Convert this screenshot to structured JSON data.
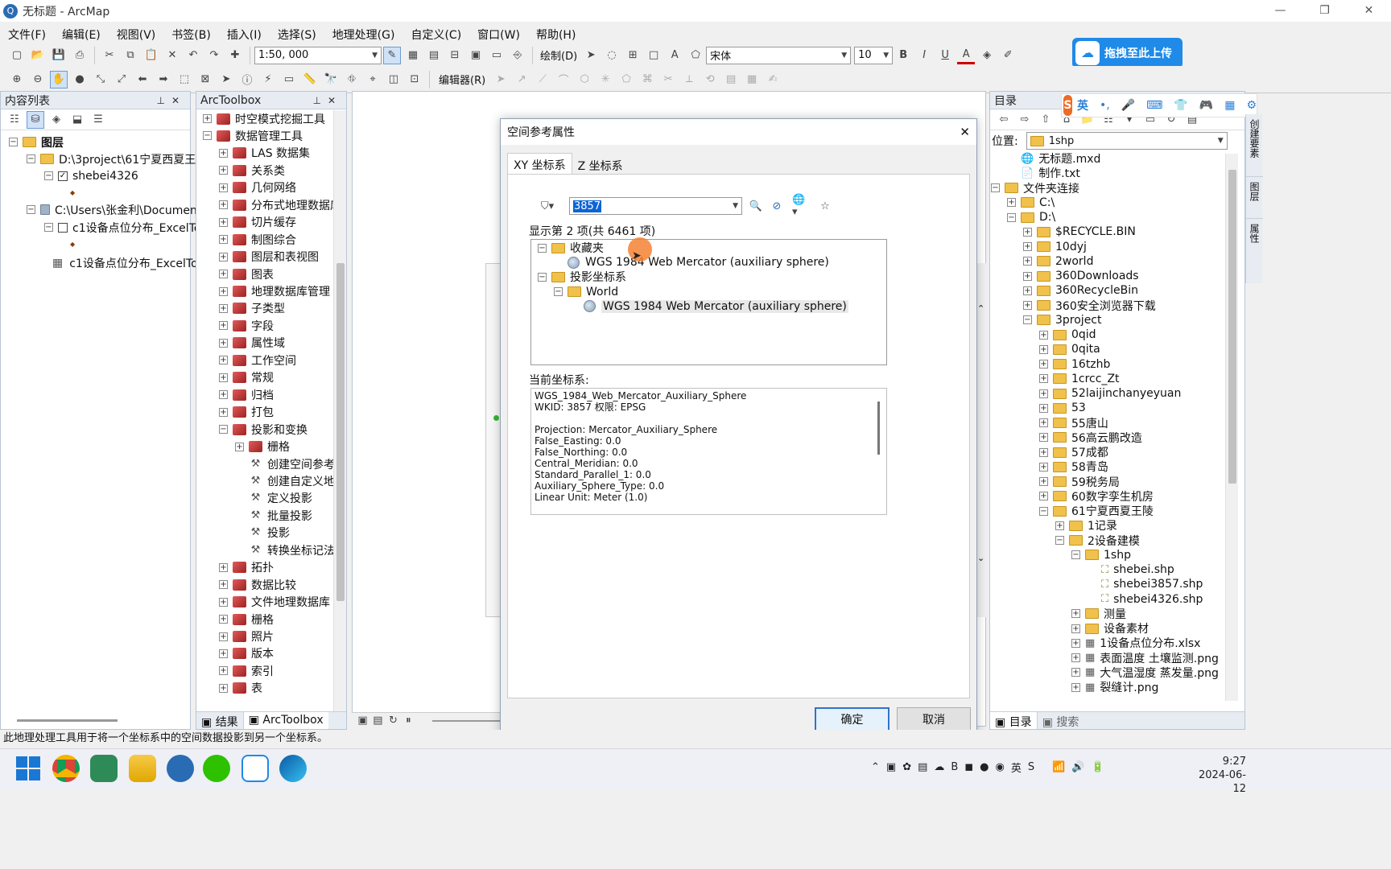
{
  "window": {
    "title": "无标题 - ArcMap",
    "minimize": "—",
    "restore": "❐",
    "close": "✕"
  },
  "menu": [
    "文件(F)",
    "编辑(E)",
    "视图(V)",
    "书签(B)",
    "插入(I)",
    "选择(S)",
    "地理处理(G)",
    "自定义(C)",
    "窗口(W)",
    "帮助(H)"
  ],
  "toolbar": {
    "scale": "1:50, 000",
    "draw_label": "绘制(D)",
    "font_name": "宋体",
    "font_size": "10",
    "bold": "B",
    "italic": "I",
    "underline": "U",
    "font_color": "A",
    "upload_button": "拖拽至此上传",
    "editor_label": "编辑器(R)"
  },
  "toc": {
    "title": "内容列表",
    "items": [
      {
        "label": "图层",
        "level": 0
      },
      {
        "label": "D:\\3project\\61宁夏西夏王陵",
        "level": 1
      },
      {
        "label": "shebei4326",
        "level": 2,
        "checked": true
      },
      {
        "label": "C:\\Users\\张金利\\Document",
        "level": 1
      },
      {
        "label": "c1设备点位分布_ExcelTo",
        "level": 2,
        "checked": false
      },
      {
        "label": "c1设备点位分布_ExcelTo",
        "level": 2,
        "table": true
      }
    ]
  },
  "toolbox": {
    "title": "ArcToolbox",
    "items": [
      {
        "label": "时空模式挖掘工具",
        "level": 0,
        "type": "box",
        "pm": "+"
      },
      {
        "label": "数据管理工具",
        "level": 0,
        "type": "box",
        "pm": "-"
      },
      {
        "label": "LAS 数据集",
        "level": 1,
        "type": "box",
        "pm": "+"
      },
      {
        "label": "关系类",
        "level": 1,
        "type": "box",
        "pm": "+"
      },
      {
        "label": "几何网络",
        "level": 1,
        "type": "box",
        "pm": "+"
      },
      {
        "label": "分布式地理数据库",
        "level": 1,
        "type": "box",
        "pm": "+"
      },
      {
        "label": "切片缓存",
        "level": 1,
        "type": "box",
        "pm": "+"
      },
      {
        "label": "制图综合",
        "level": 1,
        "type": "box",
        "pm": "+"
      },
      {
        "label": "图层和表视图",
        "level": 1,
        "type": "box",
        "pm": "+"
      },
      {
        "label": "图表",
        "level": 1,
        "type": "box",
        "pm": "+"
      },
      {
        "label": "地理数据库管理",
        "level": 1,
        "type": "box",
        "pm": "+"
      },
      {
        "label": "子类型",
        "level": 1,
        "type": "box",
        "pm": "+"
      },
      {
        "label": "字段",
        "level": 1,
        "type": "box",
        "pm": "+"
      },
      {
        "label": "属性域",
        "level": 1,
        "type": "box",
        "pm": "+"
      },
      {
        "label": "工作空间",
        "level": 1,
        "type": "box",
        "pm": "+"
      },
      {
        "label": "常规",
        "level": 1,
        "type": "box",
        "pm": "+"
      },
      {
        "label": "归档",
        "level": 1,
        "type": "box",
        "pm": "+"
      },
      {
        "label": "打包",
        "level": 1,
        "type": "box",
        "pm": "+"
      },
      {
        "label": "投影和变换",
        "level": 1,
        "type": "box",
        "pm": "-"
      },
      {
        "label": "栅格",
        "level": 2,
        "type": "box",
        "pm": "+"
      },
      {
        "label": "创建空间参考",
        "level": 2,
        "type": "tool"
      },
      {
        "label": "创建自定义地",
        "level": 2,
        "type": "tool"
      },
      {
        "label": "定义投影",
        "level": 2,
        "type": "tool"
      },
      {
        "label": "批量投影",
        "level": 2,
        "type": "tool"
      },
      {
        "label": "投影",
        "level": 2,
        "type": "tool"
      },
      {
        "label": "转换坐标记法",
        "level": 2,
        "type": "tool"
      },
      {
        "label": "拓扑",
        "level": 1,
        "type": "box",
        "pm": "+"
      },
      {
        "label": "数据比较",
        "level": 1,
        "type": "box",
        "pm": "+"
      },
      {
        "label": "文件地理数据库",
        "level": 1,
        "type": "box",
        "pm": "+"
      },
      {
        "label": "栅格",
        "level": 1,
        "type": "box",
        "pm": "+"
      },
      {
        "label": "照片",
        "level": 1,
        "type": "box",
        "pm": "+"
      },
      {
        "label": "版本",
        "level": 1,
        "type": "box",
        "pm": "+"
      },
      {
        "label": "索引",
        "level": 1,
        "type": "box",
        "pm": "+"
      },
      {
        "label": "表",
        "level": 1,
        "type": "box",
        "pm": "+"
      }
    ],
    "tab_results": "结果",
    "tab_toolbox": "ArcToolbox"
  },
  "dialog": {
    "title": "空间参考属性",
    "tabs": [
      "XY 坐标系",
      "Z 坐标系"
    ],
    "search_value": "3857",
    "result_count": "显示第 2 项(共 6461 项)",
    "tree": [
      {
        "label": "收藏夹",
        "level": 0,
        "type": "folder",
        "pm": "-"
      },
      {
        "label": "WGS 1984 Web Mercator (auxiliary sphere)",
        "level": 1,
        "type": "globe"
      },
      {
        "label": "投影坐标系",
        "level": 0,
        "type": "folder",
        "pm": "-"
      },
      {
        "label": "World",
        "level": 1,
        "type": "folder",
        "pm": "-"
      },
      {
        "label": "WGS 1984 Web Mercator (auxiliary sphere)",
        "level": 2,
        "type": "globe",
        "selected": true
      }
    ],
    "current_label": "当前坐标系:",
    "current_lines": [
      "WGS_1984_Web_Mercator_Auxiliary_Sphere",
      "WKID: 3857 权限: EPSG",
      "",
      "Projection: Mercator_Auxiliary_Sphere",
      "False_Easting: 0.0",
      "False_Northing: 0.0",
      "Central_Meridian: 0.0",
      "Standard_Parallel_1: 0.0",
      "Auxiliary_Sphere_Type: 0.0",
      "Linear Unit: Meter (1.0)"
    ],
    "ok": "确定",
    "cancel": "取消"
  },
  "catalog": {
    "title": "目录",
    "location_label": "位置:",
    "location_value": "1shp",
    "items": [
      {
        "label": "无标题.mxd",
        "level": 0,
        "type": "mxd"
      },
      {
        "label": "制作.txt",
        "level": 0,
        "type": "txt"
      },
      {
        "label": "文件夹连接",
        "level": -1,
        "type": "folder",
        "pm": "-"
      },
      {
        "label": "C:\\",
        "level": 0,
        "type": "folder",
        "pm": "+"
      },
      {
        "label": "D:\\",
        "level": 0,
        "type": "folder",
        "pm": "-"
      },
      {
        "label": "$RECYCLE.BIN",
        "level": 1,
        "type": "folder",
        "pm": "+"
      },
      {
        "label": "10dyj",
        "level": 1,
        "type": "folder",
        "pm": "+"
      },
      {
        "label": "2world",
        "level": 1,
        "type": "folder",
        "pm": "+"
      },
      {
        "label": "360Downloads",
        "level": 1,
        "type": "folder",
        "pm": "+"
      },
      {
        "label": "360RecycleBin",
        "level": 1,
        "type": "folder",
        "pm": "+"
      },
      {
        "label": "360安全浏览器下载",
        "level": 1,
        "type": "folder",
        "pm": "+"
      },
      {
        "label": "3project",
        "level": 1,
        "type": "folder",
        "pm": "-"
      },
      {
        "label": "0qid",
        "level": 2,
        "type": "folder",
        "pm": "+"
      },
      {
        "label": "0qita",
        "level": 2,
        "type": "folder",
        "pm": "+"
      },
      {
        "label": "16tzhb",
        "level": 2,
        "type": "folder",
        "pm": "+"
      },
      {
        "label": "1crcc_Zt",
        "level": 2,
        "type": "folder",
        "pm": "+"
      },
      {
        "label": "52laijinchanyeyuan",
        "level": 2,
        "type": "folder",
        "pm": "+"
      },
      {
        "label": "53",
        "level": 2,
        "type": "folder",
        "pm": "+"
      },
      {
        "label": "55唐山",
        "level": 2,
        "type": "folder",
        "pm": "+"
      },
      {
        "label": "56高云鹏改造",
        "level": 2,
        "type": "folder",
        "pm": "+"
      },
      {
        "label": "57成都",
        "level": 2,
        "type": "folder",
        "pm": "+"
      },
      {
        "label": "58青岛",
        "level": 2,
        "type": "folder",
        "pm": "+"
      },
      {
        "label": "59税务局",
        "level": 2,
        "type": "folder",
        "pm": "+"
      },
      {
        "label": "60数字孪生机房",
        "level": 2,
        "type": "folder",
        "pm": "+"
      },
      {
        "label": "61宁夏西夏王陵",
        "level": 2,
        "type": "folder",
        "pm": "-"
      },
      {
        "label": "1记录",
        "level": 3,
        "type": "folder",
        "pm": "+"
      },
      {
        "label": "2设备建模",
        "level": 3,
        "type": "folder",
        "pm": "-"
      },
      {
        "label": "1shp",
        "level": 4,
        "type": "folder",
        "pm": "-"
      },
      {
        "label": "shebei.shp",
        "level": 5,
        "type": "shp"
      },
      {
        "label": "shebei3857.shp",
        "level": 5,
        "type": "shp"
      },
      {
        "label": "shebei4326.shp",
        "level": 5,
        "type": "shp"
      },
      {
        "label": "测量",
        "level": 4,
        "type": "folder",
        "pm": "+"
      },
      {
        "label": "设备素材",
        "level": 4,
        "type": "folder",
        "pm": "+"
      },
      {
        "label": "1设备点位分布.xlsx",
        "level": 4,
        "type": "xlsx",
        "pm": "+"
      },
      {
        "label": "表面温度 土壤监测.png",
        "level": 4,
        "type": "png",
        "pm": "+"
      },
      {
        "label": "大气温湿度 蒸发量.png",
        "level": 4,
        "type": "png",
        "pm": "+"
      },
      {
        "label": "裂缝计.png",
        "level": 4,
        "type": "png",
        "pm": "+"
      }
    ],
    "tab_catalog": "目录",
    "tab_search": "搜索"
  },
  "ime": {
    "logo": "S",
    "lang": "英"
  },
  "side_tabs": [
    "创建要素",
    "图层",
    "属性"
  ],
  "status_text": "此地理处理工具用于将一个坐标系中的空间数据投影到另一个坐标系。",
  "taskbar": {
    "time": "9:27",
    "date": "2024-06-12"
  }
}
